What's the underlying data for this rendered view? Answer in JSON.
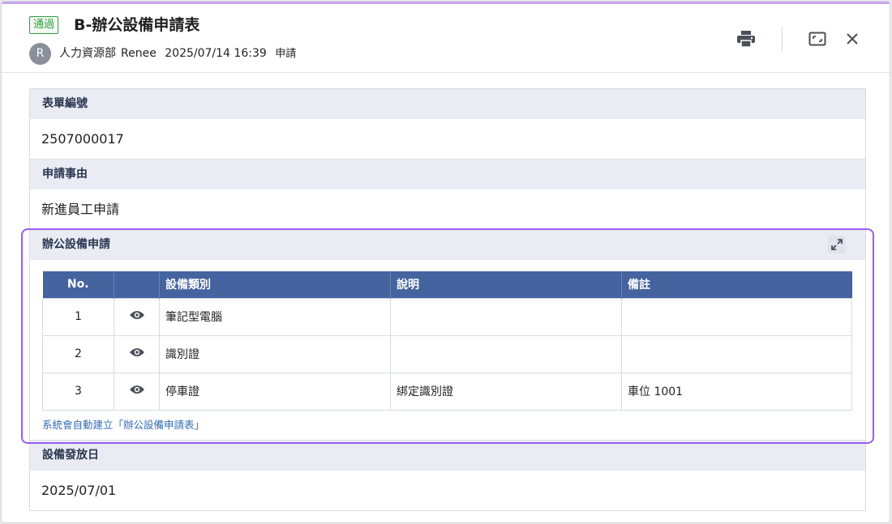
{
  "header": {
    "status": "通過",
    "title": "B-辦公設備申請表",
    "avatar_letter": "R",
    "department": "人力資源部",
    "user": "Renee",
    "datetime": "2025/07/14 16:39",
    "action": "申請"
  },
  "icons": {
    "print": "printer-icon",
    "maximize": "maximize-icon",
    "close": "close-icon",
    "expand": "expand-icon",
    "view": "eye-icon"
  },
  "colors": {
    "status_green": "#2f9e3f",
    "table_header": "#44639f",
    "section_header_bg": "#e9ecf3",
    "highlight": "#9c5cf0",
    "link": "#2f6db5"
  },
  "sections": {
    "form_no": {
      "label": "表單編號",
      "value": "2507000017"
    },
    "reason": {
      "label": "申請事由",
      "value": "新進員工申請"
    },
    "equipment": {
      "label": "辦公設備申請",
      "columns": [
        "No.",
        "",
        "設備類別",
        "說明",
        "備註"
      ],
      "rows": [
        {
          "no": "1",
          "type": "筆記型電腦",
          "desc": "",
          "remark": ""
        },
        {
          "no": "2",
          "type": "識別證",
          "desc": "",
          "remark": ""
        },
        {
          "no": "3",
          "type": "停車證",
          "desc": "綁定識別證",
          "remark": "車位 1001"
        }
      ],
      "note": "系統會自動建立「辦公設備申請表」"
    },
    "issue_date": {
      "label": "設備發放日",
      "value": "2025/07/01"
    }
  }
}
